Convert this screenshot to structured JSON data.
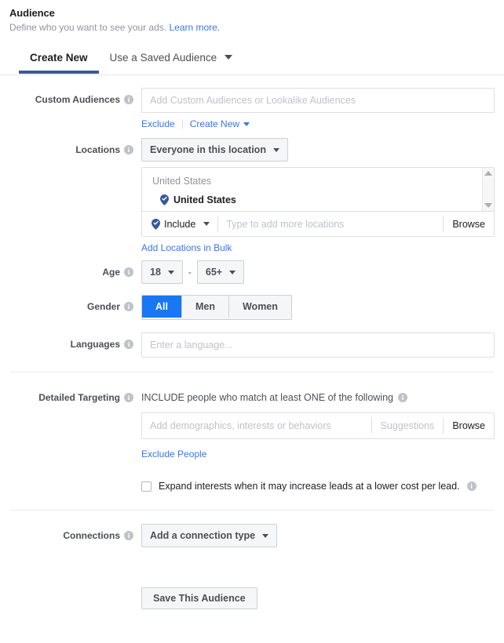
{
  "header": {
    "title": "Audience",
    "subtitle": "Define who you want to see your ads.",
    "learn_more": "Learn more."
  },
  "tabs": [
    {
      "label": "Create New",
      "active": true
    },
    {
      "label": "Use a Saved Audience",
      "active": false,
      "has_caret": true
    }
  ],
  "custom_audiences": {
    "label": "Custom Audiences",
    "placeholder": "Add Custom Audiences or Lookalike Audiences",
    "value": "",
    "exclude_link": "Exclude",
    "create_new_link": "Create New"
  },
  "locations": {
    "label": "Locations",
    "scope_select": "Everyone in this location",
    "group_title": "United States",
    "items": [
      {
        "name": "United States",
        "icon": "map-pin-check-icon"
      }
    ],
    "include_select": "Include",
    "add_placeholder": "Type to add more locations",
    "browse_label": "Browse",
    "bulk_link": "Add Locations in Bulk"
  },
  "age": {
    "label": "Age",
    "min": "18",
    "max": "65+",
    "separator": "-"
  },
  "gender": {
    "label": "Gender",
    "options": [
      {
        "label": "All",
        "active": true
      },
      {
        "label": "Men",
        "active": false
      },
      {
        "label": "Women",
        "active": false
      }
    ]
  },
  "languages": {
    "label": "Languages",
    "placeholder": "Enter a language...",
    "value": ""
  },
  "detailed_targeting": {
    "label": "Detailed Targeting",
    "heading": "INCLUDE people who match at least ONE of the following",
    "placeholder": "Add demographics, interests or behaviors",
    "value": "",
    "suggestions_label": "Suggestions",
    "browse_label": "Browse",
    "exclude_link": "Exclude People"
  },
  "expand_interests": {
    "label": "Expand interests when it may increase leads at a lower cost per lead.",
    "checked": false
  },
  "connections": {
    "label": "Connections",
    "select": "Add a connection type"
  },
  "footer": {
    "save_label": "Save This Audience"
  },
  "colors": {
    "accent_blue": "#1877f2",
    "tab_underline": "#3b5998",
    "link": "#3578e5",
    "muted_text": "#90949c",
    "border": "#dddfe2",
    "pin_blue": "#365899"
  }
}
